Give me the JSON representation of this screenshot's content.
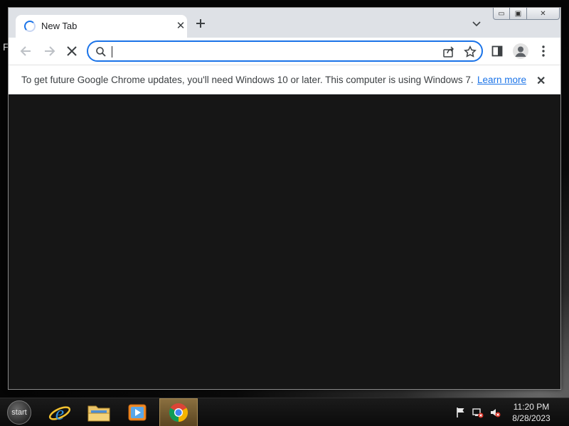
{
  "desktop": {
    "partial_text": "F"
  },
  "browser": {
    "tab": {
      "title": "New Tab",
      "close_icon": "close-icon",
      "loading_icon": "loading-spinner-icon"
    },
    "new_tab_icon": "plus-icon",
    "tab_search_icon": "chevron-down-icon",
    "window_controls": {
      "minimize": "▭",
      "maximize": "▣",
      "close": "✕"
    },
    "toolbar": {
      "back_icon": "arrow-left-icon",
      "forward_icon": "arrow-right-icon",
      "stop_icon": "close-icon",
      "omnibox": {
        "value": "",
        "placeholder": ""
      },
      "share_icon": "share-icon",
      "bookmark_icon": "star-icon",
      "side_panel_icon": "side-panel-icon",
      "profile_icon": "avatar-icon",
      "menu_icon": "kebab-menu-icon"
    },
    "infobar": {
      "message": "To get future Google Chrome updates, you'll need Windows 10 or later. This computer is using Windows 7.",
      "link": "Learn more",
      "close": "✕"
    },
    "accent_color": "#1a73e8",
    "content_background": "#161616"
  },
  "taskbar": {
    "start_label": "start",
    "pinned": [
      {
        "name": "Internet Explorer",
        "icon": "internet-explorer-icon",
        "active": false
      },
      {
        "name": "File Explorer",
        "icon": "folder-icon",
        "active": false
      },
      {
        "name": "Media Player",
        "icon": "media-player-icon",
        "active": false
      },
      {
        "name": "Google Chrome",
        "icon": "chrome-icon",
        "active": true
      }
    ],
    "tray": [
      "flag-icon",
      "network-icon",
      "volume-muted-icon"
    ],
    "clock": {
      "time": "11:20 PM",
      "date": "8/28/2023"
    }
  }
}
